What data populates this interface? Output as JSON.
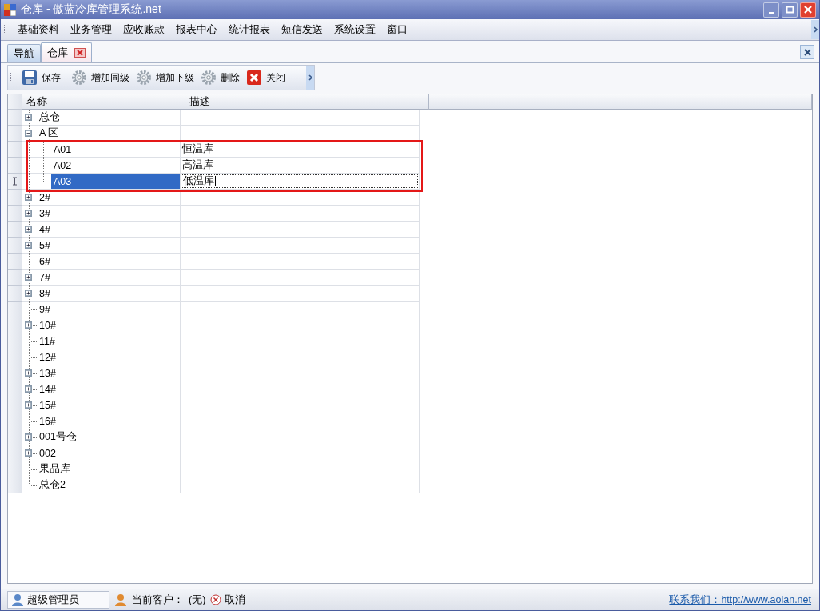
{
  "window": {
    "title": "仓库 - 傲蓝冷库管理系统.net"
  },
  "menu": [
    "基础资料",
    "业务管理",
    "应收账款",
    "报表中心",
    "统计报表",
    "短信发送",
    "系统设置",
    "窗口"
  ],
  "tabs": [
    {
      "label": "导航",
      "selected": false,
      "closable": false
    },
    {
      "label": "仓库",
      "selected": true,
      "closable": true
    }
  ],
  "toolbar": [
    {
      "label": "保存",
      "kind": "save"
    },
    {
      "label": "增加同级",
      "kind": "gear"
    },
    {
      "label": "增加下级",
      "kind": "gear"
    },
    {
      "label": "删除",
      "kind": "gear"
    },
    {
      "label": "关闭",
      "kind": "close"
    }
  ],
  "tree": {
    "columns": [
      "名称",
      "描述"
    ],
    "nodes": [
      {
        "name": "总仓",
        "kind": "folder",
        "expanded": false,
        "selected": false
      },
      {
        "name": "A 区",
        "kind": "folder",
        "expanded": true,
        "selected": false,
        "highlight_children": true,
        "children": [
          {
            "name": "A01",
            "description": "恒温库",
            "kind": "leaf",
            "selected": false
          },
          {
            "name": "A02",
            "description": "高温库",
            "kind": "leaf",
            "selected": false
          },
          {
            "name": "A03",
            "description": "低温库",
            "kind": "leaf",
            "selected": true,
            "editing": true
          }
        ]
      },
      {
        "name": "2#",
        "kind": "folder",
        "expanded": false,
        "selected": false
      },
      {
        "name": "3#",
        "kind": "folder",
        "expanded": false,
        "selected": false
      },
      {
        "name": "4#",
        "kind": "folder",
        "expanded": false,
        "selected": false
      },
      {
        "name": "5#",
        "kind": "folder",
        "expanded": false,
        "selected": false
      },
      {
        "name": "6#",
        "kind": "leaf",
        "selected": false
      },
      {
        "name": "7#",
        "kind": "folder",
        "expanded": false,
        "selected": false
      },
      {
        "name": "8#",
        "kind": "folder",
        "expanded": false,
        "selected": false
      },
      {
        "name": "9#",
        "kind": "leaf",
        "selected": false
      },
      {
        "name": "10#",
        "kind": "folder",
        "expanded": false,
        "selected": false
      },
      {
        "name": "11#",
        "kind": "leaf",
        "selected": false
      },
      {
        "name": "12#",
        "kind": "leaf",
        "selected": false
      },
      {
        "name": "13#",
        "kind": "folder",
        "expanded": false,
        "selected": false
      },
      {
        "name": "14#",
        "kind": "folder",
        "expanded": false,
        "selected": false
      },
      {
        "name": "15#",
        "kind": "folder",
        "expanded": false,
        "selected": false
      },
      {
        "name": "16#",
        "kind": "leaf",
        "selected": false
      },
      {
        "name": "001号仓",
        "kind": "folder",
        "expanded": false,
        "selected": false
      },
      {
        "name": "002",
        "kind": "folder",
        "expanded": false,
        "selected": false
      },
      {
        "name": "果品库",
        "kind": "leaf",
        "selected": false
      },
      {
        "name": "总仓2",
        "kind": "leaf",
        "selected": false
      }
    ]
  },
  "status_bar": {
    "user": "超级管理员",
    "customer_label": "当前客户：",
    "customer": "(无)",
    "cancel": "取消",
    "contact": "联系我们：http://www.aolan.net"
  }
}
